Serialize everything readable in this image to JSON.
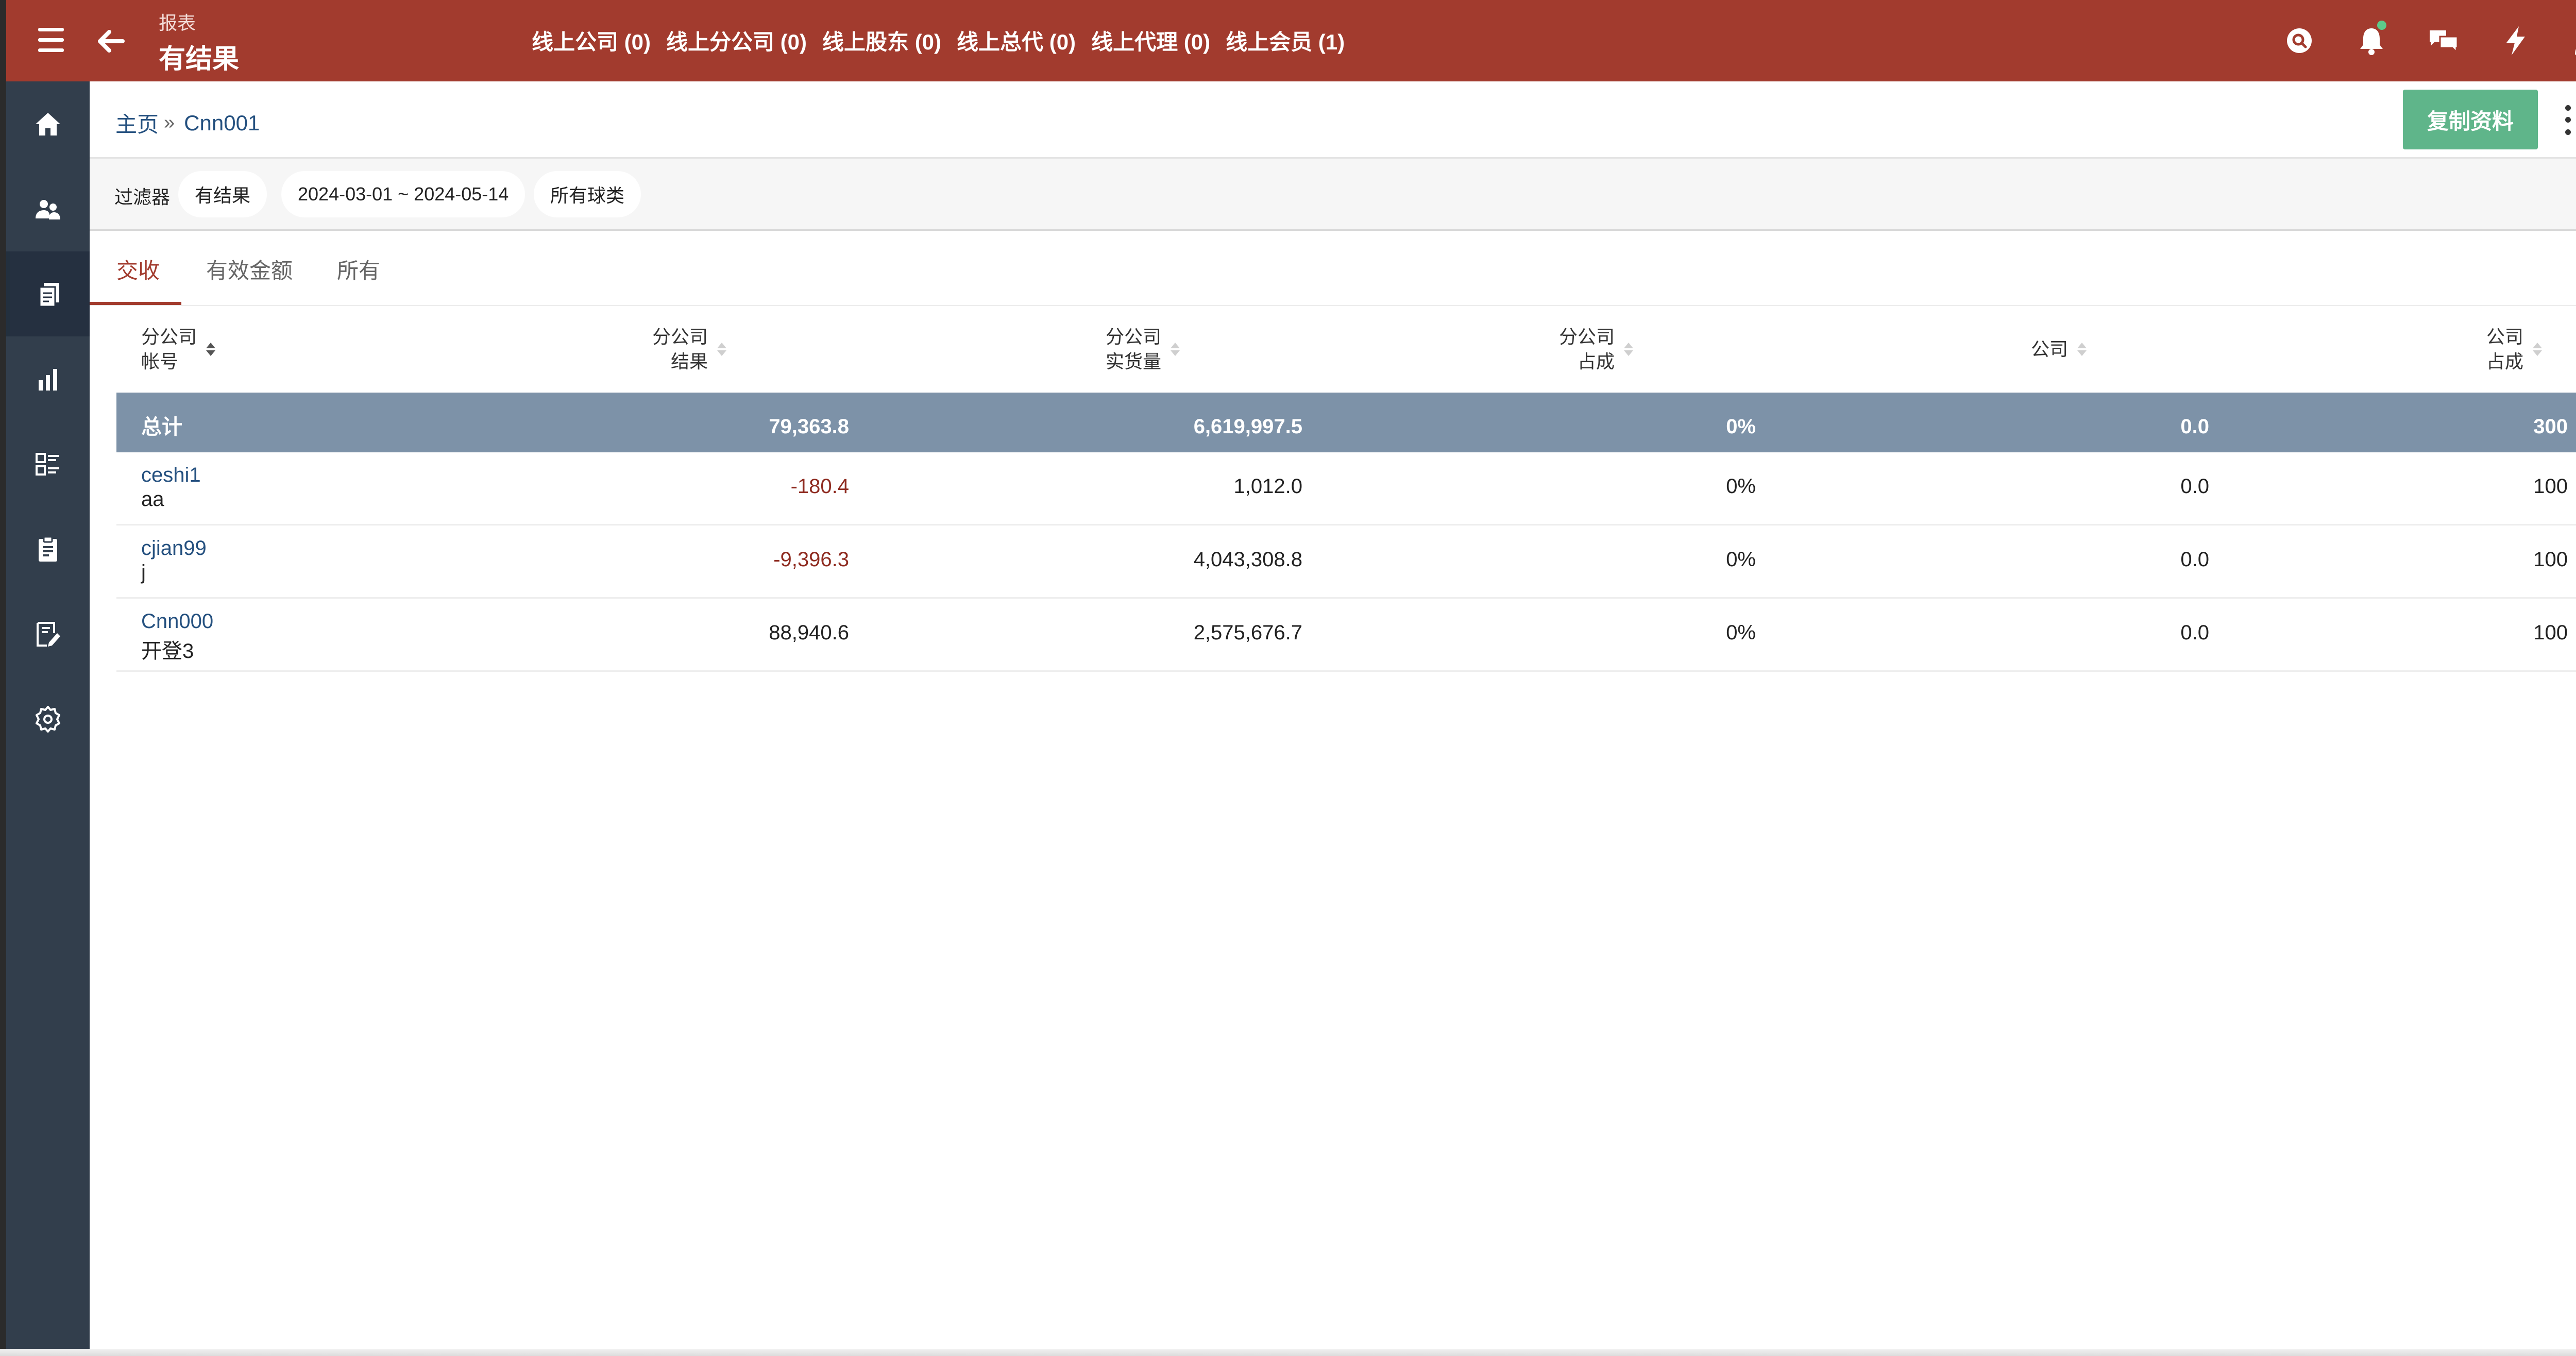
{
  "topbar": {
    "pre_title": "报表",
    "title": "有结果",
    "nav": [
      "线上公司 (0)",
      "线上分公司 (0)",
      "线上股东 (0)",
      "线上总代 (0)",
      "线上代理 (0)",
      "线上会员 (1)"
    ],
    "icons": [
      "search-icon",
      "bell-icon",
      "chat-icon",
      "bolt-icon",
      "user-icon"
    ],
    "accent_color": "#a23b2e"
  },
  "sidebar": {
    "items": [
      "home-icon",
      "users-icon",
      "reports-icon",
      "chart-icon",
      "list-icon",
      "clipboard-icon",
      "edit-note-icon",
      "settings-icon"
    ],
    "active_index": 2
  },
  "breadcrumb": {
    "home": "主页",
    "separator": "»",
    "current": "Cnn001"
  },
  "actions": {
    "copy_label": "复制资料"
  },
  "filters": {
    "label": "过滤器",
    "chips": [
      "有结果",
      "2024-03-01 ~ 2024-05-14",
      "所有球类"
    ]
  },
  "tabs": [
    "交收",
    "有效金额",
    "所有"
  ],
  "table": {
    "headers": [
      [
        "分公司",
        "帐号"
      ],
      [
        "分公司",
        "结果"
      ],
      [
        "分公司",
        "实货量"
      ],
      [
        "分公司",
        "占成"
      ],
      [
        "公司"
      ],
      [
        "公司",
        "占成"
      ]
    ],
    "total": {
      "label": "总计",
      "values": [
        "79,363.8",
        "6,619,997.5",
        "0%",
        "0.0",
        "300"
      ]
    },
    "rows": [
      {
        "account": "ceshi1",
        "nickname": "aa",
        "values": [
          "-180.4",
          "1,012.0",
          "0%",
          "0.0",
          "100"
        ],
        "negative": true
      },
      {
        "account": "cjian99",
        "nickname": "j",
        "values": [
          "-9,396.3",
          "4,043,308.8",
          "0%",
          "0.0",
          "100"
        ],
        "negative": true
      },
      {
        "account": "Cnn000",
        "nickname": "开登3",
        "values": [
          "88,940.6",
          "2,575,676.7",
          "0%",
          "0.0",
          "100"
        ],
        "negative": false
      }
    ]
  }
}
